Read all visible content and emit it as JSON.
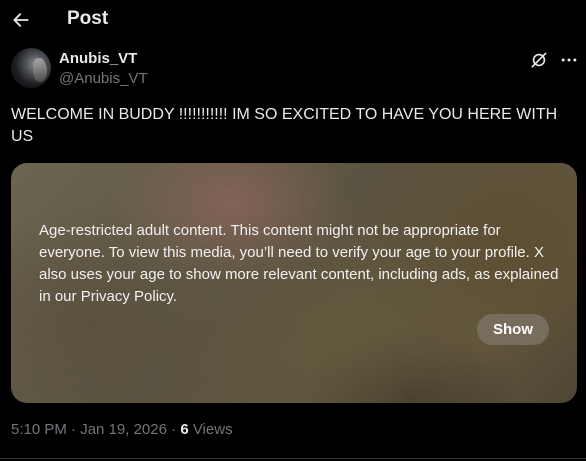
{
  "header": {
    "title": "Post"
  },
  "author": {
    "display_name": "Anubis_VT",
    "handle": "@Anubis_VT"
  },
  "post": {
    "text": "WELCOME IN BUDDY !!!!!!!!!!! IM SO EXCITED TO HAVE YOU HERE WITH US"
  },
  "media": {
    "warning": "Age-restricted adult content. This content might not be appropriate for everyone. To view this media, you’ll need to verify your age to your profile. X also uses your age to show more relevant content, including ads, as explained in our Privacy Policy.",
    "show_label": "Show"
  },
  "meta": {
    "time": "5:10 PM",
    "sep1": " · ",
    "date": "Jan 19, 2026",
    "sep2": " · ",
    "views_count": "6",
    "views_label": " Views"
  },
  "icons": {
    "back": "arrow-left-icon",
    "grok": "grok-icon",
    "more": "more-icon"
  },
  "colors": {
    "background": "#000000",
    "text": "#e7e9ea",
    "secondary_text": "#71767b"
  }
}
